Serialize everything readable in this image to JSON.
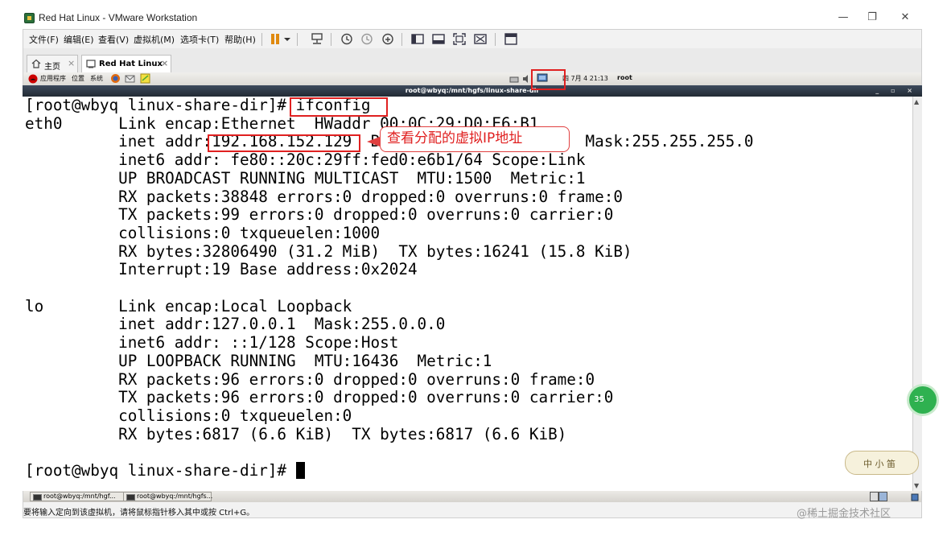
{
  "window": {
    "title": "Red Hat Linux - VMware Workstation",
    "controls": {
      "minimize": "—",
      "restore": "❐",
      "close": "✕"
    }
  },
  "menubar": {
    "items": [
      "文件(F)",
      "编辑(E)",
      "查看(V)",
      "虚拟机(M)",
      "选项卡(T)",
      "帮助(H)"
    ]
  },
  "toolbar_icons": [
    "pause-icon",
    "dropdown-icon",
    "network-icon",
    "snapshot-icon",
    "snapshot-restore-icon",
    "snapshot-manager-icon",
    "sidebar-icon",
    "thumbnail-icon",
    "fullscreen-icon",
    "unity-icon",
    "console-view-icon"
  ],
  "tabs": [
    {
      "label": "主页",
      "icon": "home-icon",
      "close": "×",
      "active": false
    },
    {
      "label": "Red Hat Linux",
      "icon": "vm-icon",
      "close": "×",
      "active": true
    }
  ],
  "gnome_panel": {
    "applications": "应用程序",
    "places": "位置",
    "system": "系统",
    "clock": "四 7月  4 21:13",
    "user": "root"
  },
  "terminal": {
    "title": "root@wbyq:/mnt/hgfs/linux-share-dir",
    "window_controls": "_ ▫ ×",
    "lines": [
      "[root@wbyq linux-share-dir]# ifconfig",
      "eth0      Link encap:Ethernet  HWaddr 00:0C:29:D0:E6:B1",
      "          inet addr:192.168.152.129  Bcast:192.168.152.255  Mask:255.255.255.0",
      "          inet6 addr: fe80::20c:29ff:fed0:e6b1/64 Scope:Link",
      "          UP BROADCAST RUNNING MULTICAST  MTU:1500  Metric:1",
      "          RX packets:38848 errors:0 dropped:0 overruns:0 frame:0",
      "          TX packets:99 errors:0 dropped:0 overruns:0 carrier:0",
      "          collisions:0 txqueuelen:1000",
      "          RX bytes:32806490 (31.2 MiB)  TX bytes:16241 (15.8 KiB)",
      "          Interrupt:19 Base address:0x2024",
      "",
      "lo        Link encap:Local Loopback",
      "          inet addr:127.0.0.1  Mask:255.0.0.0",
      "          inet6 addr: ::1/128 Scope:Host",
      "          UP LOOPBACK RUNNING  MTU:16436  Metric:1",
      "          RX packets:96 errors:0 dropped:0 overruns:0 frame:0",
      "          TX packets:96 errors:0 dropped:0 overruns:0 carrier:0",
      "          collisions:0 txqueuelen:0",
      "          RX bytes:6817 (6.6 KiB)  TX bytes:6817 (6.6 KiB)",
      "",
      "[root@wbyq linux-share-dir]# "
    ]
  },
  "annotation": {
    "callout_text": "查看分配的虚拟IP地址",
    "highlight_color": "#e02020"
  },
  "taskbar": {
    "items": [
      "root@wbyq:/mnt/hgf...",
      "root@wbyq:/mnt/hgfs..."
    ]
  },
  "statusbar": {
    "text": "要将输入定向到该虚拟机，请将鼠标指针移入其中或按 Ctrl+G。"
  },
  "overlays": {
    "badge": "35",
    "sticker": "中 小 笛",
    "watermark": "@稀土掘金技术社区"
  }
}
